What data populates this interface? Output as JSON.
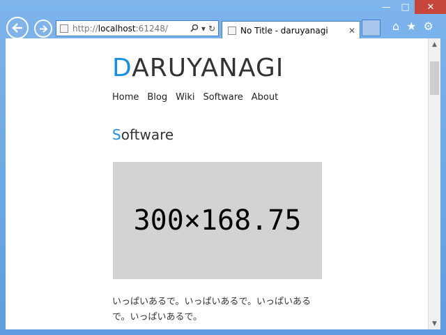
{
  "window": {
    "minimize_glyph": "—",
    "maximize_glyph": "□",
    "close_glyph": "✕"
  },
  "address_bar": {
    "protocol": "http://",
    "host": "localhost",
    "port": ":61248/",
    "search_icon": "magnifier-icon",
    "dropdown_glyph": "▾",
    "refresh_glyph": "↻"
  },
  "tab": {
    "title": "No Title - daruyanagi",
    "close_glyph": "✕"
  },
  "toolbar_icons": {
    "home": "⌂",
    "favorites": "★",
    "settings": "⚙"
  },
  "site": {
    "name_first": "D",
    "name_rest": "ARUYANAGI",
    "nav": [
      "Home",
      "Blog",
      "Wiki",
      "Software",
      "About"
    ]
  },
  "page": {
    "heading_first": "S",
    "heading_rest": "oftware",
    "image_placeholder": "300×168.75",
    "paragraph": "いっぱいあるで。いっぱいあるで。いっぱいあるで。いっぱいあるで。"
  },
  "colors": {
    "accent": "#1a8fe0",
    "chrome": "#6aa6e6",
    "close_button": "#c7463c",
    "placeholder_bg": "#d3d3d3"
  }
}
